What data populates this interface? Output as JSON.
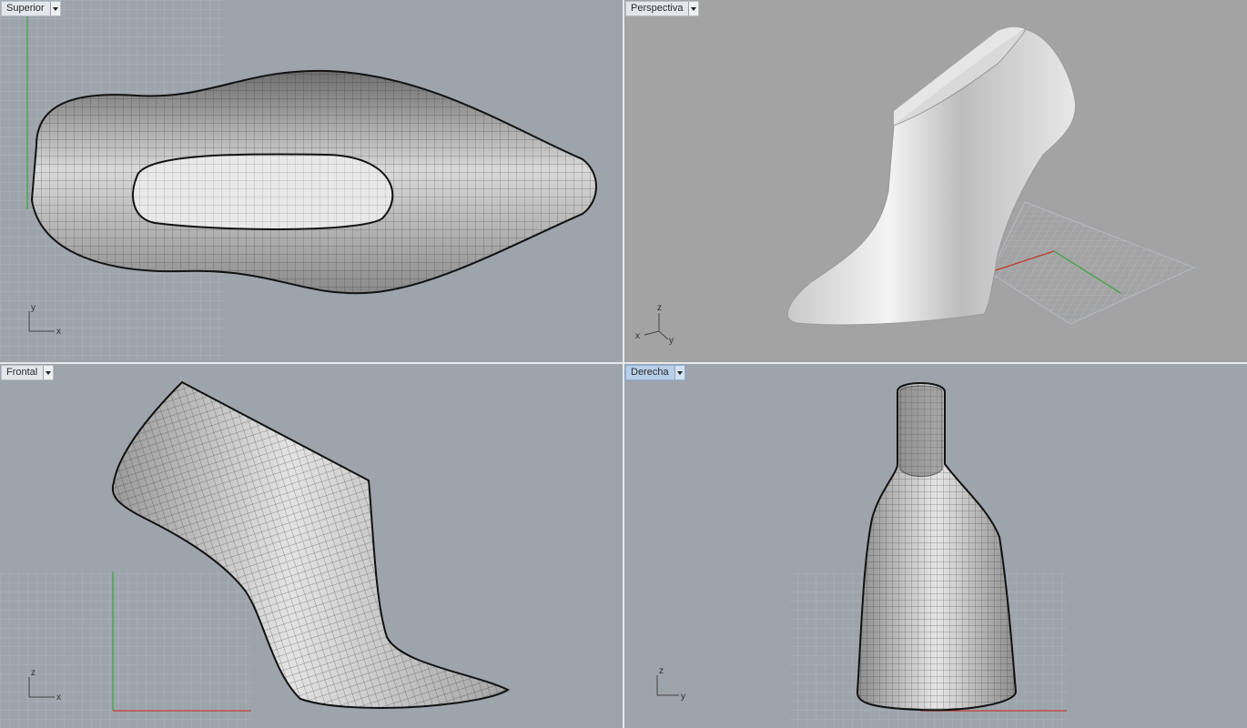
{
  "viewports": {
    "top": {
      "title": "Superior",
      "axes": {
        "vertical": "y",
        "horizontal": "x"
      }
    },
    "persp": {
      "title": "Perspectiva",
      "axes": {
        "z": "z",
        "x": "x",
        "y": "y"
      }
    },
    "front": {
      "title": "Frontal",
      "axes": {
        "vertical": "z",
        "horizontal": "x"
      }
    },
    "right": {
      "title": "Derecha",
      "axes": {
        "vertical": "z",
        "horizontal": "y"
      },
      "active": true
    }
  },
  "colors": {
    "viewport_bg": "#9da4ac",
    "persp_bg": "#a3a3a3",
    "grid_line": "#b7bcc2",
    "x_axis": "#c0392b",
    "y_axis": "#3aa63a",
    "active_tab": "#b7cfe8"
  },
  "icons": {
    "viewport_menu": "triangle-down-icon",
    "axes_widget": "axes-triad-icon"
  }
}
